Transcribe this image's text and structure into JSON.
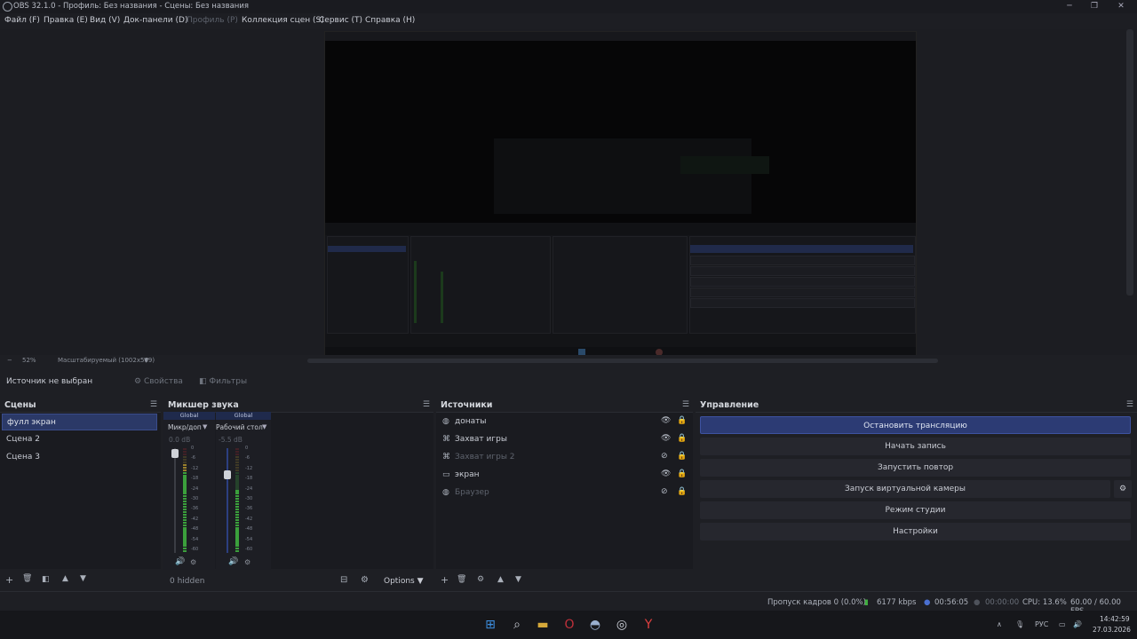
{
  "window": {
    "title": "OBS 32.1.0 - Профиль: Без названия - Сцены: Без названия",
    "controls": {
      "minimize": "─",
      "maximize": "❐",
      "close": "✕"
    }
  },
  "menu": [
    {
      "label": "Файл (F)",
      "disabled": false
    },
    {
      "label": "Правка (E)",
      "disabled": false
    },
    {
      "label": "Вид (V)",
      "disabled": false
    },
    {
      "label": "Док-панели (D)",
      "disabled": false
    },
    {
      "label": "Профиль (P)",
      "disabled": true
    },
    {
      "label": "Коллекция сцен (S)",
      "disabled": false
    },
    {
      "label": "Сервис (T)",
      "disabled": false
    },
    {
      "label": "Справка (H)",
      "disabled": false
    }
  ],
  "zoombar": {
    "minus": "−",
    "zoom": "52%",
    "mode": "Масштабируемый (1002x569)",
    "dropdown": "▼"
  },
  "context": {
    "no_source": "Источник не выбран",
    "properties": "Свойства",
    "filters": "Фильтры"
  },
  "scenes": {
    "title": "Сцены",
    "items": [
      "фулл экран",
      "Сцена 2",
      "Сцена 3"
    ],
    "selected_index": 0
  },
  "mixer": {
    "title": "Микшер звука",
    "channels": [
      {
        "global": "Global",
        "name": "Микр/доп",
        "db": "0.0 dB",
        "level": 0.85
      },
      {
        "global": "Global",
        "name": "Рабочий стол",
        "db": "-5.5 dB",
        "level": 0.6
      }
    ],
    "ticks": [
      "0",
      "-6",
      "-12",
      "-18",
      "-24",
      "-30",
      "-36",
      "-42",
      "-48",
      "-54",
      "-60"
    ],
    "hidden_label": "0 hidden",
    "options_label": "Options"
  },
  "sources": {
    "title": "Источники",
    "items": [
      {
        "label": "донаты",
        "icon": "globe-icon",
        "glyph": "◍",
        "visible": true
      },
      {
        "label": "Захват игры",
        "icon": "gamepad-icon",
        "glyph": "⌘",
        "visible": true
      },
      {
        "label": "Захват игры 2",
        "icon": "gamepad-icon",
        "glyph": "⌘",
        "visible": false
      },
      {
        "label": "экран",
        "icon": "monitor-icon",
        "glyph": "▭",
        "visible": true
      },
      {
        "label": "Браузер",
        "icon": "globe-icon",
        "glyph": "◍",
        "visible": false
      }
    ]
  },
  "controls": {
    "title": "Управление",
    "buttons": [
      "Остановить трансляцию",
      "Начать запись",
      "Запустить повтор",
      "Запуск виртуальной камеры",
      "Режим студии",
      "Настройки"
    ]
  },
  "status": {
    "dropped": "Пропуск кадров 0 (0.0%)",
    "bitrate": "6177 kbps",
    "stream_time": "00:56:05",
    "rec_time": "00:00:00",
    "cpu": "CPU: 13.6%",
    "fps": "60.00 / 60.00 FPS"
  },
  "taskbar": {
    "lang": "РУС",
    "time": "14:42:59",
    "date": "27.03.2026"
  },
  "colors": {
    "accent": "#2c3b74",
    "meter_green": "#3fae3f",
    "meter_red": "#b0282d"
  }
}
